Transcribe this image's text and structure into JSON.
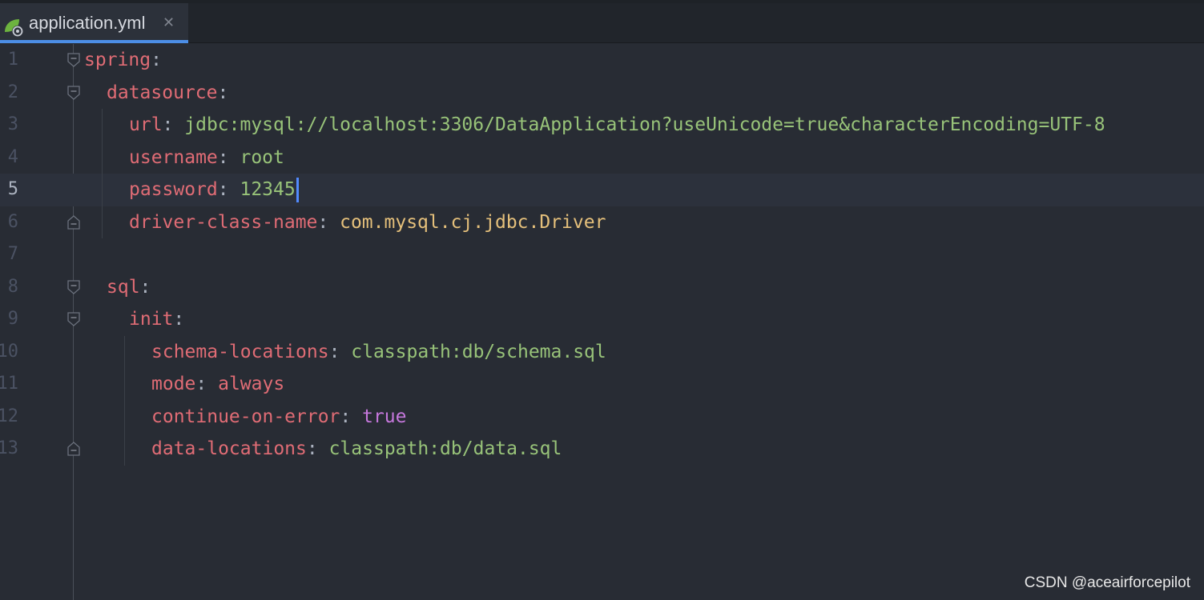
{
  "tab": {
    "filename": "application.yml",
    "close": "✕",
    "icon": "spring-leaf-icon"
  },
  "lines": [
    {
      "num": "1",
      "key": "spring",
      "sep": ":",
      "value": "",
      "valclass": ""
    },
    {
      "num": "2",
      "key": "datasource",
      "sep": ":",
      "value": "",
      "valclass": ""
    },
    {
      "num": "3",
      "key": "url",
      "sep": ": ",
      "value": "jdbc:mysql://localhost:3306/DataApplication?useUnicode=true&characterEncoding=UTF-8",
      "valclass": "s"
    },
    {
      "num": "4",
      "key": "username",
      "sep": ": ",
      "value": "root",
      "valclass": "s"
    },
    {
      "num": "5",
      "key": "password",
      "sep": ": ",
      "value": "12345",
      "valclass": "s"
    },
    {
      "num": "6",
      "key": "driver-class-name",
      "sep": ": ",
      "value": "com.mysql.cj.jdbc.Driver",
      "valclass": "c"
    },
    {
      "num": "7",
      "key": "",
      "sep": "",
      "value": "",
      "valclass": ""
    },
    {
      "num": "8",
      "key": "sql",
      "sep": ":",
      "value": "",
      "valclass": ""
    },
    {
      "num": "9",
      "key": "init",
      "sep": ":",
      "value": "",
      "valclass": ""
    },
    {
      "num": "10",
      "key": "schema-locations",
      "sep": ": ",
      "value": "classpath:db/schema.sql",
      "valclass": "s"
    },
    {
      "num": "11",
      "key": "mode",
      "sep": ": ",
      "value": "always",
      "valclass": "k"
    },
    {
      "num": "12",
      "key": "continue-on-error",
      "sep": ": ",
      "value": "true",
      "valclass": "b"
    },
    {
      "num": "13",
      "key": "data-locations",
      "sep": ": ",
      "value": "classpath:db/data.sql",
      "valclass": "s"
    }
  ],
  "current_line": "5",
  "watermark": "CSDN @aceairforcepilot",
  "colors": {
    "background": "#282c34",
    "key": "#e06c75",
    "string": "#98c379",
    "class": "#e5c07b",
    "boolean": "#c678dd",
    "caret": "#528bff",
    "tab_underline": "#4c8ee6"
  }
}
